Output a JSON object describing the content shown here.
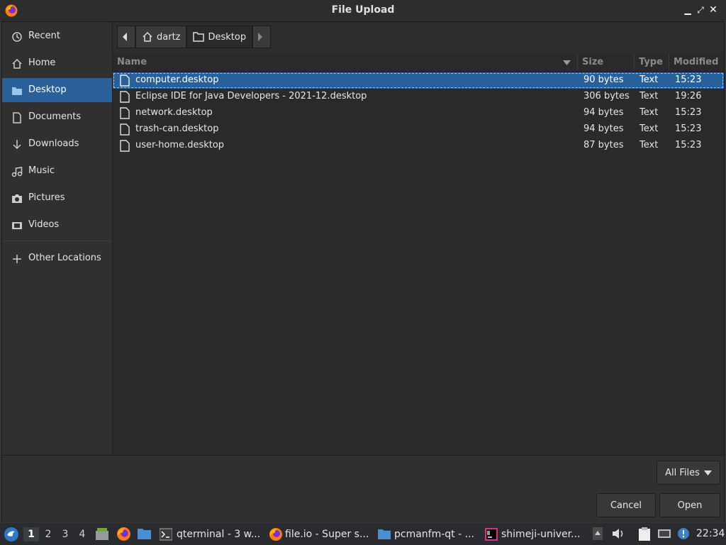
{
  "window": {
    "title": "File Upload"
  },
  "sidebar": {
    "items": [
      {
        "label": "Recent",
        "icon": "clock-icon"
      },
      {
        "label": "Home",
        "icon": "home-icon"
      },
      {
        "label": "Desktop",
        "icon": "folder-icon"
      },
      {
        "label": "Documents",
        "icon": "document-icon"
      },
      {
        "label": "Downloads",
        "icon": "download-icon"
      },
      {
        "label": "Music",
        "icon": "music-icon"
      },
      {
        "label": "Pictures",
        "icon": "camera-icon"
      },
      {
        "label": "Videos",
        "icon": "video-icon"
      }
    ],
    "other_locations": "Other Locations",
    "active": "Desktop"
  },
  "pathbar": {
    "home": "dartz",
    "current": "Desktop"
  },
  "columns": {
    "name": "Name",
    "size": "Size",
    "type": "Type",
    "modified": "Modified"
  },
  "files": [
    {
      "name": "computer.desktop",
      "size": "90 bytes",
      "type": "Text",
      "modified": "15:23",
      "selected": true
    },
    {
      "name": "Eclipse IDE for Java Developers - 2021-12.desktop",
      "size": "306 bytes",
      "type": "Text",
      "modified": "19:26",
      "selected": false
    },
    {
      "name": "network.desktop",
      "size": "94 bytes",
      "type": "Text",
      "modified": "15:23",
      "selected": false
    },
    {
      "name": "trash-can.desktop",
      "size": "94 bytes",
      "type": "Text",
      "modified": "15:23",
      "selected": false
    },
    {
      "name": "user-home.desktop",
      "size": "87 bytes",
      "type": "Text",
      "modified": "15:23",
      "selected": false
    }
  ],
  "filter": {
    "label": "All Files"
  },
  "buttons": {
    "cancel": "Cancel",
    "open": "Open"
  },
  "taskbar": {
    "workspaces": [
      "1",
      "2",
      "3",
      "4"
    ],
    "tasks": [
      {
        "label": "qterminal - 3 w..."
      },
      {
        "label": "file.io - Super s..."
      },
      {
        "label": "pcmanfm-qt - ..."
      },
      {
        "label": "shimeji-univer..."
      }
    ],
    "clock": "22:34"
  },
  "colors": {
    "accent": "#2a6099",
    "background": "#2b2b2b"
  }
}
